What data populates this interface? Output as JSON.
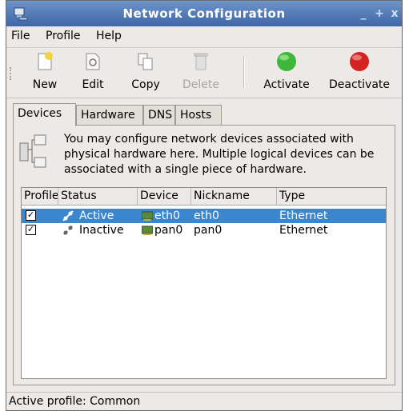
{
  "window": {
    "title": "Network Configuration"
  },
  "titlebar_buttons": {
    "minimize": "_",
    "maximize": "+",
    "close": "x"
  },
  "menu": {
    "file": "File",
    "profile": "Profile",
    "help": "Help"
  },
  "toolbar": {
    "new_label": "New",
    "edit_label": "Edit",
    "copy_label": "Copy",
    "delete_label": "Delete",
    "activate_label": "Activate",
    "deactivate_label": "Deactivate"
  },
  "tabs": [
    "Devices",
    "Hardware",
    "DNS",
    "Hosts"
  ],
  "info_text": "You may configure network devices associated with physical hardware here.  Multiple logical devices can be associated with a single piece of hardware.",
  "columns": {
    "profile": "Profile",
    "status": "Status",
    "device": "Device",
    "nickname": "Nickname",
    "type": "Type"
  },
  "rows": [
    {
      "profile": "☑",
      "status": "Active",
      "device": "eth0",
      "nickname": "eth0",
      "type": "Ethernet",
      "selected": true
    },
    {
      "profile": "☑",
      "status": "Inactive",
      "device": "pan0",
      "nickname": "pan0",
      "type": "Ethernet",
      "selected": false
    }
  ],
  "statusbar": {
    "text": "Active profile: Common"
  },
  "colors": {
    "titlebar": "#4f77b5",
    "selection": "#3a86cf",
    "activate": "#3fb83a",
    "deactivate": "#d42222"
  }
}
